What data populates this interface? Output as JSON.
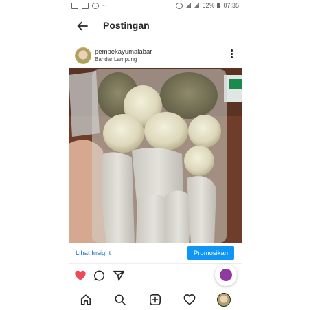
{
  "status_bar": {
    "dots": "··",
    "battery": "52%",
    "time": "07:35"
  },
  "header": {
    "title": "Postingan"
  },
  "post": {
    "username": "pempekayumalabar",
    "location": "Bandar Lampung"
  },
  "insight": {
    "view_label": "Lihat Insight",
    "promote_label": "Promosikan"
  },
  "colors": {
    "accent_blue": "#0f95f6",
    "link_blue": "#1d78c9",
    "like_red": "#ed4956"
  },
  "icons": {
    "back": "arrow-left-icon",
    "more": "more-vertical-icon",
    "like": "heart-filled-icon",
    "comment": "comment-icon",
    "share": "send-icon",
    "home": "home-icon",
    "search": "search-icon",
    "new_post": "plus-square-icon",
    "activity": "heart-outline-icon"
  }
}
